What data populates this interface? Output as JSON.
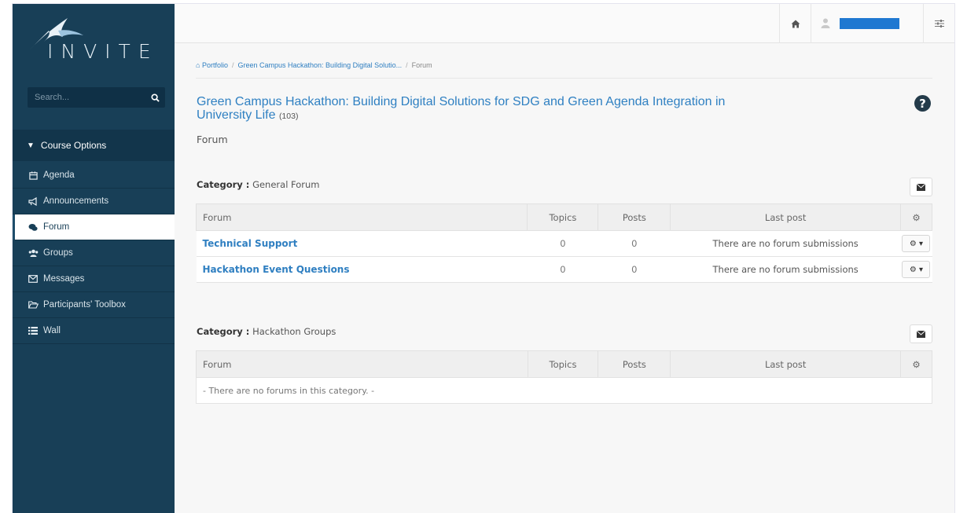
{
  "brand": {
    "name": "INVITE"
  },
  "sidebar": {
    "search_placeholder": "Search...",
    "course_options_label": "Course Options",
    "items": [
      {
        "label": "Agenda",
        "icon": "calendar-icon",
        "glyph": "▦"
      },
      {
        "label": "Announcements",
        "icon": "bullhorn-icon",
        "glyph": "◀"
      },
      {
        "label": "Forum",
        "icon": "comments-icon",
        "glyph": "●"
      },
      {
        "label": "Groups",
        "icon": "users-icon",
        "glyph": "👥"
      },
      {
        "label": "Messages",
        "icon": "envelope-icon",
        "glyph": "✉"
      },
      {
        "label": "Participants' Toolbox",
        "icon": "folder-open-icon",
        "glyph": "▱"
      },
      {
        "label": "Wall",
        "icon": "list-icon",
        "glyph": "≡"
      }
    ],
    "active_item": "Forum"
  },
  "topbar": {
    "home_icon": "home-icon",
    "user_icon": "user-icon",
    "settings_icon": "sliders-icon"
  },
  "breadcrumb": {
    "root": "Portfolio",
    "course": "Green Campus Hackathon: Building Digital Solutio...",
    "current": "Forum"
  },
  "course": {
    "title": "Green Campus Hackathon: Building Digital Solutions for SDG and Green Agenda Integration in University Life",
    "count": "(103)"
  },
  "page": {
    "subtitle": "Forum"
  },
  "columns": {
    "forum": "Forum",
    "topics": "Topics",
    "posts": "Posts",
    "last_post": "Last post"
  },
  "categories": [
    {
      "prefix": "Category :",
      "name": "General Forum",
      "forums": [
        {
          "name": "Technical Support",
          "topics": "0",
          "posts": "0",
          "last_post": "There are no forum submissions"
        },
        {
          "name": "Hackathon Event Questions",
          "topics": "0",
          "posts": "0",
          "last_post": "There are no forum submissions"
        }
      ]
    },
    {
      "prefix": "Category :",
      "name": "Hackathon Groups",
      "empty_message": "- There are no forums in this category. -"
    }
  ],
  "colors": {
    "sidebar_bg": "#183f57",
    "link": "#2f7fc1",
    "user_bar": "#1f78d1"
  }
}
